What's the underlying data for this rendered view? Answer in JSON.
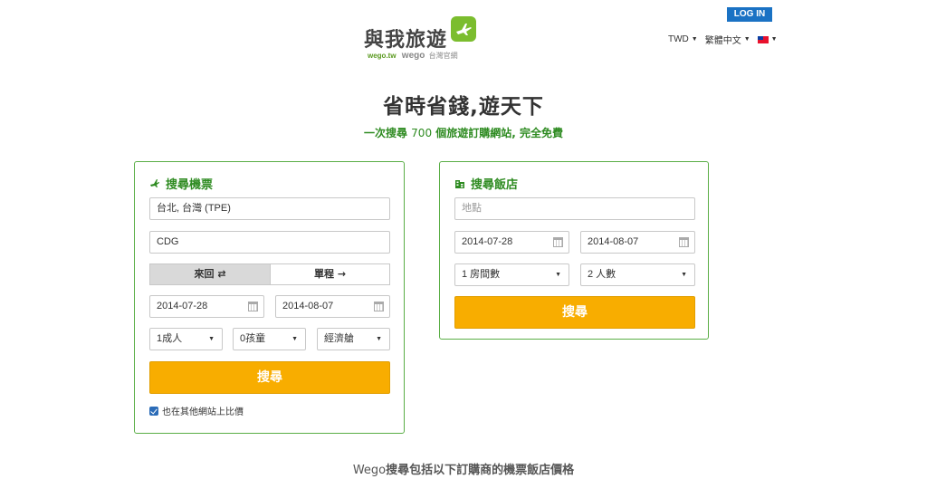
{
  "header": {
    "login_label": "LOG IN",
    "currency": "TWD",
    "language": "繁體中文",
    "logo_main": "與我旅遊",
    "logo_domain": "wego.tw",
    "logo_brand": "wego",
    "logo_official": "台灣官網"
  },
  "hero": {
    "title": "省時省錢,遊天下",
    "subtitle_pre": "一次搜尋",
    "subtitle_num": "700",
    "subtitle_post": "個旅遊訂購網站, 完全免費"
  },
  "flight": {
    "title": "搜尋機票",
    "origin": "台北, 台灣 (TPE)",
    "destination": "CDG",
    "roundtrip_label": "來回",
    "oneway_label": "單程",
    "depart_date": "2014-07-28",
    "return_date": "2014-08-07",
    "adults": "1成人",
    "children": "0孩童",
    "cabin": "經濟艙",
    "search_label": "搜尋",
    "compare_label": "也在其他網站上比價",
    "compare_checked": true
  },
  "hotel": {
    "title": "搜尋飯店",
    "location_placeholder": "地點",
    "checkin_date": "2014-07-28",
    "checkout_date": "2014-08-07",
    "rooms": "1 房間數",
    "guests": "2 人數",
    "search_label": "搜尋"
  },
  "footer": {
    "text_brand": "Wego",
    "text_rest": "搜尋包括以下訂購商的機票飯店價格"
  },
  "colors": {
    "accent_green": "#2e8b21",
    "border_green": "#5aae46",
    "search_orange": "#f8ad00",
    "login_blue": "#1a72c4"
  }
}
